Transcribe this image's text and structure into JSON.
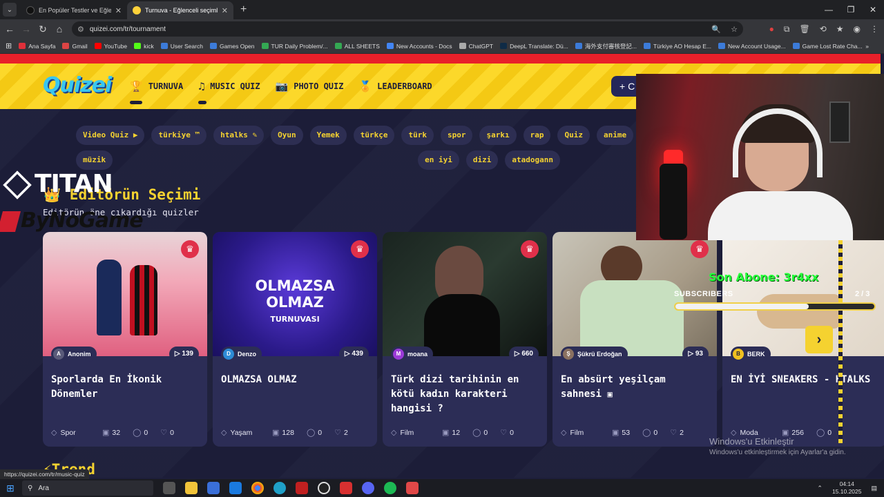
{
  "browser": {
    "tabs": [
      {
        "title": "En Popüler Testler ve Eğlenceli",
        "active": false
      },
      {
        "title": "Turnuva - Eğlenceli seçimler ya",
        "active": true
      }
    ],
    "url": "quizei.com/tr/tournament",
    "bookmarks": [
      "Ana Sayfa",
      "Gmail",
      "YouTube",
      "kick",
      "User Search",
      "Games Open",
      "TUR Daily Problem/...",
      "ALL SHEETS",
      "New Accounts - Docs",
      "ChatGPT",
      "DeepL Translate: Dü...",
      "海外支付審核登記...",
      "Türkiye AO Hesap E...",
      "New Account Usage...",
      "Game Lost Rate Cha..."
    ]
  },
  "site": {
    "logo": "Quizei",
    "nav": [
      "TURNUVA",
      "MUSIC QUIZ",
      "PHOTO QUIZ",
      "LEADERBOARD"
    ],
    "create_label": "+ C",
    "chips": [
      "Video Quiz ▶",
      "türkiye ™",
      "htalks ✎",
      "Oyun",
      "Yemek",
      "türkçe",
      "türk",
      "spor",
      "şarkı",
      "rap",
      "Quiz",
      "anime",
      "müzik",
      "en iyi",
      "dizi",
      "atadogann"
    ]
  },
  "overlay": {
    "titan": "TITAN",
    "bynogame": "ByNoGame"
  },
  "section": {
    "title": "Editörün Seçimi",
    "subtitle": "Editörün öne çıkardığı quizler",
    "trend": "Trend"
  },
  "cards": [
    {
      "author": "Anonim",
      "author_initial": "A",
      "plays": "139",
      "title": "Sporlarda En İkonik Dönemler",
      "category": "Spor",
      "items": "32",
      "comments": "0",
      "likes": "0"
    },
    {
      "author": "Denzo",
      "author_initial": "D",
      "plays": "439",
      "title": "OLMAZSA OLMAZ",
      "category": "Yaşam",
      "items": "128",
      "comments": "0",
      "likes": "2",
      "banner": [
        "OLMAZSA",
        "OLMAZ",
        "TURNUVASI"
      ]
    },
    {
      "author": "moana",
      "author_initial": "M",
      "plays": "660",
      "title": "Türk dizi tarihinin en kötü kadın karakteri hangisi ?",
      "category": "Film",
      "items": "12",
      "comments": "0",
      "likes": "0"
    },
    {
      "author": "Şükrü Erdoğan",
      "author_initial": "Ş",
      "plays": "93",
      "title": "En absürt yeşilçam sahnesi",
      "category": "Film",
      "items": "53",
      "comments": "0",
      "likes": "2"
    },
    {
      "author": "BERK",
      "author_initial": "B",
      "plays": "",
      "title": "EN İYİ SNEAKERS - HTALKS",
      "category": "Moda",
      "items": "256",
      "comments": "0",
      "likes": ""
    }
  ],
  "stream": {
    "last_sub": "Son Abone: 3r4xx",
    "sub_label": "SUBSCRIBERS",
    "sub_count": "2 / 3",
    "sub_progress": 0.67
  },
  "windows": {
    "activate_title": "Windows'u Etkinleştir",
    "activate_sub": "Windows'u etkinleştirmek için Ayarlar'a gidin.",
    "status_url": "https://quizei.com/tr/music-quiz",
    "search": "Ara",
    "time": "04:14",
    "date": "15.10.2025"
  }
}
